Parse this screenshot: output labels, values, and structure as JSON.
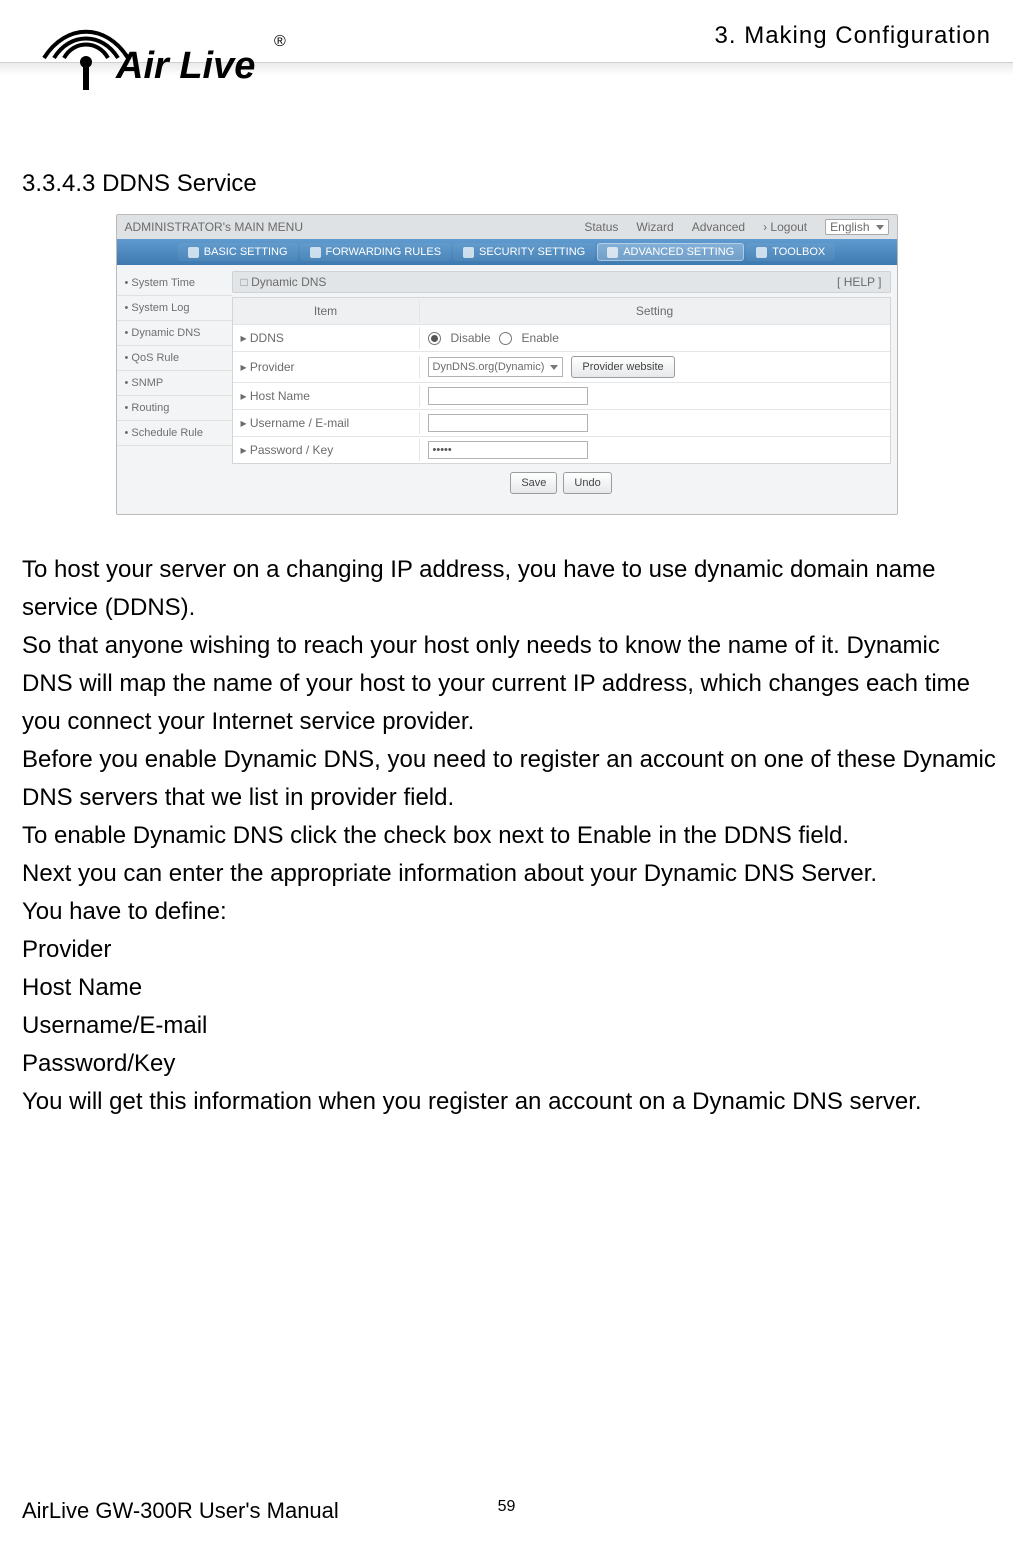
{
  "doc": {
    "chapter_label": "3. Making Configuration",
    "section_heading": "3.3.4.3 DDNS Service",
    "paragraphs": {
      "p1": "To host your server on a changing IP address, you have to use dynamic domain name service (DDNS).",
      "p2": "So that anyone wishing to reach your host only needs to know the name of it. Dynamic DNS will map the name of your host to your current IP address, which changes each time you connect your Internet service provider.",
      "p3": "Before you enable Dynamic DNS, you need to register an account on one of these Dynamic DNS servers that we list in provider field.",
      "p4": "To enable Dynamic DNS click the check box next to Enable in the DDNS field.",
      "p5": "Next you can enter the appropriate information about your Dynamic DNS Server.",
      "p6": "You have to define:",
      "p7": "Provider",
      "p8": "Host Name",
      "p9": "Username/E-mail",
      "p10": "Password/Key",
      "p11": "You will get this information when you register an account on a Dynamic DNS server."
    },
    "footer_title": "AirLive GW-300R User's Manual",
    "page_number": "59"
  },
  "screenshot": {
    "topbar": {
      "menu_label": "ADMINISTRATOR's MAIN MENU",
      "status": "Status",
      "wizard": "Wizard",
      "advanced": "Advanced",
      "logout": "› Logout",
      "language": "English"
    },
    "tabs": {
      "basic": "BASIC SETTING",
      "forwarding": "FORWARDING RULES",
      "security": "SECURITY SETTING",
      "advanced": "ADVANCED SETTING",
      "toolbox": "TOOLBOX"
    },
    "sidebar": {
      "i0": "• System Time",
      "i1": "• System Log",
      "i2": "• Dynamic DNS",
      "i3": "• QoS Rule",
      "i4": "• SNMP",
      "i5": "• Routing",
      "i6": "• Schedule Rule"
    },
    "panel": {
      "title": "Dynamic DNS",
      "help": "[ HELP ]",
      "col_item": "Item",
      "col_setting": "Setting",
      "rows": {
        "ddns_label": "▸ DDNS",
        "ddns_disable": "Disable",
        "ddns_enable": "Enable",
        "provider_label": "▸ Provider",
        "provider_value": "DynDNS.org(Dynamic)",
        "provider_btn": "Provider website",
        "hostname_label": "▸ Host Name",
        "username_label": "▸ Username / E-mail",
        "password_label": "▸ Password / Key",
        "password_value": "•••••"
      },
      "actions": {
        "save": "Save",
        "undo": "Undo"
      }
    }
  }
}
